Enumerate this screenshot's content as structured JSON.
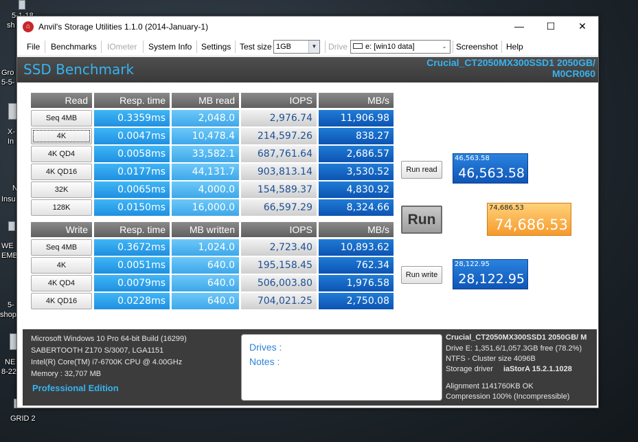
{
  "desktop": {
    "labels": [
      {
        "id": "d1",
        "text": "5-1-18"
      },
      {
        "id": "d2",
        "text": "sh"
      },
      {
        "id": "d3",
        "text": "Gro"
      },
      {
        "id": "d4",
        "text": "5-5-"
      },
      {
        "id": "d5",
        "text": "X-"
      },
      {
        "id": "d6",
        "text": "In"
      },
      {
        "id": "d7",
        "text": "N"
      },
      {
        "id": "d8",
        "text": "Insu"
      },
      {
        "id": "d9",
        "text": "WE"
      },
      {
        "id": "d10",
        "text": "EMB"
      },
      {
        "id": "d11",
        "text": "5-"
      },
      {
        "id": "d12",
        "text": "shop"
      },
      {
        "id": "d13",
        "text": "NE"
      },
      {
        "id": "d14",
        "text": "8-22"
      },
      {
        "id": "d15",
        "text": "GRID 2"
      }
    ]
  },
  "window": {
    "title": "Anvil's Storage Utilities 1.1.0 (2014-January-1)",
    "minimize": "—",
    "maximize": "☐",
    "close": "✕"
  },
  "menu": {
    "file": "File",
    "benchmarks": "Benchmarks",
    "iometer": "IOmeter",
    "system_info": "System Info",
    "settings": "Settings",
    "test_size_label": "Test size",
    "test_size_value": "1GB",
    "drive_label": "Drive",
    "drive_value": "e: [win10 data]",
    "screenshot": "Screenshot",
    "help": "Help"
  },
  "banner": {
    "title": "SSD Benchmark",
    "drive_line1": "Crucial_CT2050MX300SSD1 2050GB/",
    "drive_line2": "M0CR060"
  },
  "read": {
    "headers": [
      "Read",
      "Resp. time",
      "MB read",
      "IOPS",
      "MB/s"
    ],
    "rows": [
      {
        "label": "Seq 4MB",
        "resp": "0.3359ms",
        "mb": "2,048.0",
        "iops": "2,976.74",
        "mbs": "11,906.98"
      },
      {
        "label": "4K",
        "resp": "0.0047ms",
        "mb": "10,478.4",
        "iops": "214,597.26",
        "mbs": "838.27"
      },
      {
        "label": "4K QD4",
        "resp": "0.0058ms",
        "mb": "33,582.1",
        "iops": "687,761.64",
        "mbs": "2,686.57"
      },
      {
        "label": "4K QD16",
        "resp": "0.0177ms",
        "mb": "44,131.7",
        "iops": "903,813.14",
        "mbs": "3,530.52"
      },
      {
        "label": "32K",
        "resp": "0.0065ms",
        "mb": "4,000.0",
        "iops": "154,589.37",
        "mbs": "4,830.92"
      },
      {
        "label": "128K",
        "resp": "0.0150ms",
        "mb": "16,000.0",
        "iops": "66,597.29",
        "mbs": "8,324.66"
      }
    ]
  },
  "write": {
    "headers": [
      "Write",
      "Resp. time",
      "MB written",
      "IOPS",
      "MB/s"
    ],
    "rows": [
      {
        "label": "Seq 4MB",
        "resp": "0.3672ms",
        "mb": "1,024.0",
        "iops": "2,723.40",
        "mbs": "10,893.62"
      },
      {
        "label": "4K",
        "resp": "0.0051ms",
        "mb": "640.0",
        "iops": "195,158.45",
        "mbs": "762.34"
      },
      {
        "label": "4K QD4",
        "resp": "0.0079ms",
        "mb": "640.0",
        "iops": "506,003.80",
        "mbs": "1,976.58"
      },
      {
        "label": "4K QD16",
        "resp": "0.0228ms",
        "mb": "640.0",
        "iops": "704,021.25",
        "mbs": "2,750.08"
      }
    ]
  },
  "actions": {
    "run_read": "Run read",
    "run": "Run",
    "run_write": "Run write"
  },
  "scores": {
    "read_small": "46,563.58",
    "read_big": "46,563.58",
    "total_small": "74,686.53",
    "total_big": "74,686.53",
    "write_small": "28,122.95",
    "write_big": "28,122.95"
  },
  "system": {
    "os": "Microsoft Windows 10 Pro 64-bit Build (16299)",
    "board": "SABERTOOTH Z170 S/3007, LGA1151",
    "cpu": "Intel(R) Core(TM) i7-6700K CPU @ 4.00GHz",
    "memory": "Memory : 32,707 MB",
    "edition": "Professional Edition"
  },
  "notes": {
    "drives_label": "Drives :",
    "notes_label": "Notes :"
  },
  "drive_info": {
    "name": "Crucial_CT2050MX300SSD1 2050GB/ M",
    "free": "Drive E: 1,351.6/1,057.3GB free (78.2%)",
    "fs": "NTFS - Cluster size 4096B",
    "driver_label": "Storage driver",
    "driver_value": "iaStorA 15.2.1.1028",
    "alignment": "Alignment 1141760KB OK",
    "compression": "Compression 100% (Incompressible)"
  },
  "colors": {
    "accent_blue": "#36b3f1",
    "resp_blue": "#1f8fe0",
    "mbs_blue": "#0d53b2",
    "total_orange": "#f59a2c"
  }
}
